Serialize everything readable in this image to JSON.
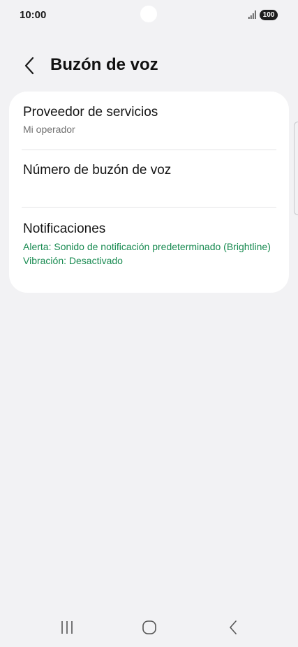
{
  "status_bar": {
    "time": "10:00",
    "battery": "100",
    "signal_icon": "signal-bars-icon"
  },
  "header": {
    "back_icon": "chevron-left-icon",
    "title": "Buzón de voz"
  },
  "settings": {
    "service_provider": {
      "title": "Proveedor de servicios",
      "subtitle": "Mi operador"
    },
    "voicemail_number": {
      "title": "Número de buzón de voz"
    },
    "notifications": {
      "title": "Notificaciones",
      "alert": "Alerta: Sonido de notificación predeterminado (Brightline)",
      "vibration": "Vibración: Desactivado"
    }
  },
  "colors": {
    "background": "#f2f2f4",
    "card": "#ffffff",
    "accent_green": "#178a50",
    "secondary_text": "#707070"
  },
  "nav_bar": {
    "recents_icon": "recents-icon",
    "home_icon": "home-icon",
    "back_icon": "back-icon"
  }
}
